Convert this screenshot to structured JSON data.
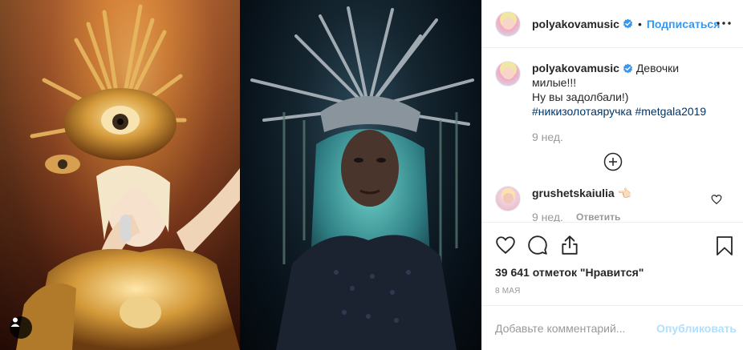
{
  "header": {
    "username": "polyakovamusic",
    "separator": "•",
    "follow_label": "Подписаться"
  },
  "caption": {
    "username": "polyakovamusic",
    "text_line1": "Девочки милые!!!",
    "text_line2": "Ну вы задолбали!)",
    "hashtag1": "#никизолотаяручка",
    "hashtag2": "#metgala2019",
    "time": "9 нед."
  },
  "comments": [
    {
      "username": "grushetskaiulia",
      "emoji": "👈🏻",
      "time": "9 нед.",
      "reply_label": "Ответить"
    }
  ],
  "likes_text": "39 641 отметок \"Нравится\"",
  "date": "8 мая",
  "add_comment": {
    "placeholder": "Добавьте комментарий...",
    "publish_label": "Опубликовать"
  },
  "colors": {
    "link_blue": "#3897f0",
    "publish_disabled": "#b2dffc",
    "hashtag": "#003569",
    "muted": "#999999"
  },
  "icons": [
    "verified-icon",
    "more-icon",
    "load-more-icon",
    "heart-icon",
    "comment-icon",
    "share-icon",
    "bookmark-icon",
    "user-tag-icon"
  ]
}
